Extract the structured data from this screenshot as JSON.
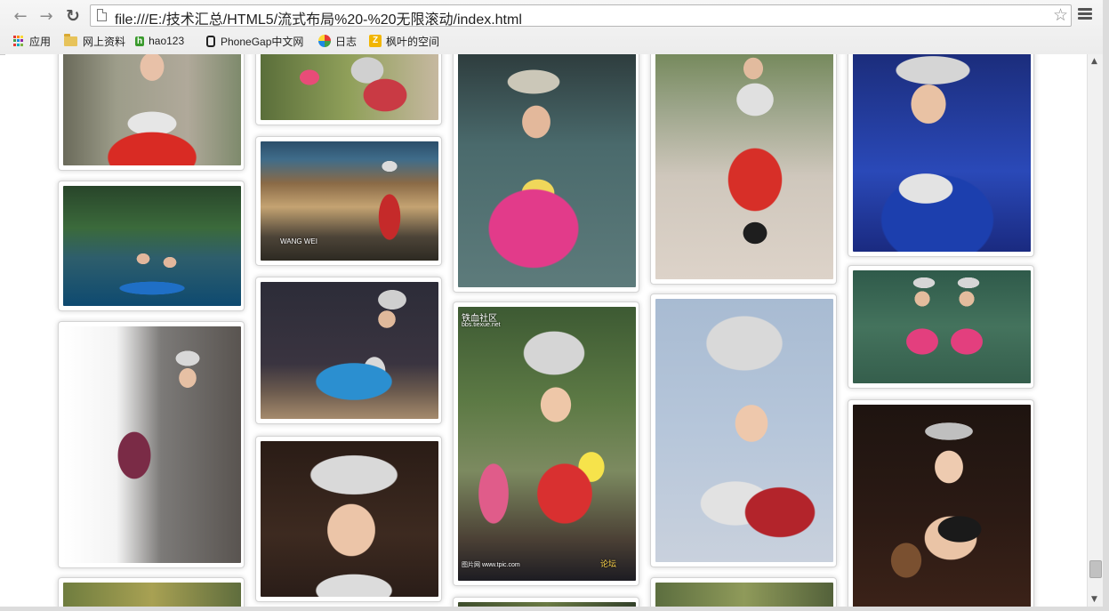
{
  "browser": {
    "url": "file:///E:/技术汇总/HTML5/流式布局%20-%20无限滚动/index.html",
    "nav": {
      "back": "←",
      "forward": "→",
      "reload": "↻",
      "star": "☆"
    }
  },
  "bookmarks": [
    {
      "label": "应用",
      "icon": "apps-grid-icon"
    },
    {
      "label": "网上资料",
      "icon": "folder-icon"
    },
    {
      "label": "hao123",
      "icon": "hao123-icon"
    },
    {
      "label": "PhoneGap中文网",
      "icon": "phonegap-icon"
    },
    {
      "label": "日志",
      "icon": "diary-icon"
    },
    {
      "label": "枫叶的空间",
      "icon": "qzone-icon"
    }
  ],
  "gallery": {
    "photo_texts": {
      "wang_wei": "WANG WEI",
      "tiexue": "铁血社区",
      "tiexue_url": "bbs.tiexue.net",
      "credit": "图片网 www.tpic.com",
      "luntan": "论坛"
    }
  },
  "colors": {
    "card_border": "#d4d4d4",
    "background": "#ffffff",
    "chrome": "#ececec"
  }
}
